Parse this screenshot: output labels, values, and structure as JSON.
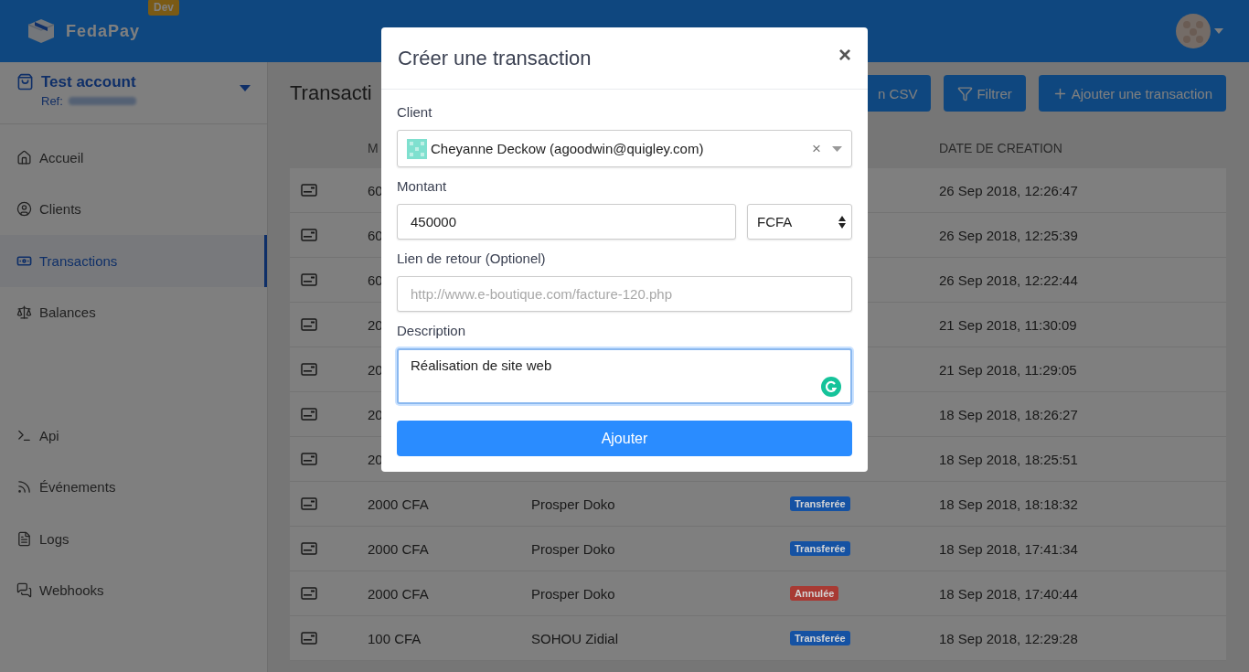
{
  "header": {
    "logo": "FedaPay",
    "badge": "Dev"
  },
  "account": {
    "name": "Test account",
    "ref_label": "Ref:"
  },
  "sidebar": {
    "items": [
      {
        "label": "Accueil",
        "selected": false
      },
      {
        "label": "Clients",
        "selected": false
      },
      {
        "label": "Transactions",
        "selected": true
      },
      {
        "label": "Balances",
        "selected": false
      }
    ],
    "dev_items": [
      {
        "label": "Api",
        "selected": false
      },
      {
        "label": "Événements",
        "selected": false
      },
      {
        "label": "Logs",
        "selected": false
      },
      {
        "label": "Webhooks",
        "selected": false
      }
    ]
  },
  "page": {
    "title": "Transacti",
    "buttons": [
      {
        "label": "n CSV",
        "kind": "plain"
      },
      {
        "label": "Filtrer",
        "kind": "filter"
      },
      {
        "label": "Ajouter une transaction",
        "kind": "add"
      }
    ]
  },
  "table": {
    "columns": [
      {
        "label": "M"
      },
      {
        "label": "DATE DE CREATION"
      }
    ],
    "rows": [
      {
        "amount": "60",
        "date": "26 Sep 2018, 12:26:47"
      },
      {
        "amount": "60",
        "date": "26 Sep 2018, 12:25:39"
      },
      {
        "amount": "60",
        "date": "26 Sep 2018, 12:22:44"
      },
      {
        "amount": "20",
        "date": "21 Sep 2018, 11:30:09"
      },
      {
        "amount": "20",
        "date": "21 Sep 2018, 11:29:05"
      },
      {
        "amount": "20",
        "date": "18 Sep 2018, 18:26:27"
      },
      {
        "amount": "20",
        "date": "18 Sep 2018, 18:25:51"
      },
      {
        "amount": "2000 CFA",
        "client": "Prosper Doko",
        "status": {
          "label": "Transferée",
          "color": "#1552a3"
        },
        "date": "18 Sep 2018, 18:18:32"
      },
      {
        "amount": "2000 CFA",
        "client": "Prosper Doko",
        "status": {
          "label": "Transferée",
          "color": "#1552a3"
        },
        "date": "18 Sep 2018, 17:41:34"
      },
      {
        "amount": "2000 CFA",
        "client": "Prosper Doko",
        "status": {
          "label": "Annulée",
          "color": "#a83a33"
        },
        "date": "18 Sep 2018, 17:40:44"
      },
      {
        "amount": "100 CFA",
        "client": "SOHOU Zidial",
        "status": {
          "label": "Transferée",
          "color": "#1552a3"
        },
        "date": "18 Sep 2018, 12:29:28"
      }
    ]
  },
  "modal": {
    "title": "Créer une transaction",
    "close": "×",
    "client": {
      "label": "Client",
      "value": "Cheyanne Deckow (agoodwin@quigley.com)",
      "clear": "×"
    },
    "amount": {
      "label": "Montant",
      "value": "450000",
      "currency": "FCFA"
    },
    "return_link": {
      "label": "Lien de retour (Optionel)",
      "placeholder": "http://www.e-boutique.com/facture-120.php"
    },
    "description": {
      "label": "Description",
      "value": "Réalisation de site web",
      "focused": true
    },
    "submit": "Ajouter"
  }
}
